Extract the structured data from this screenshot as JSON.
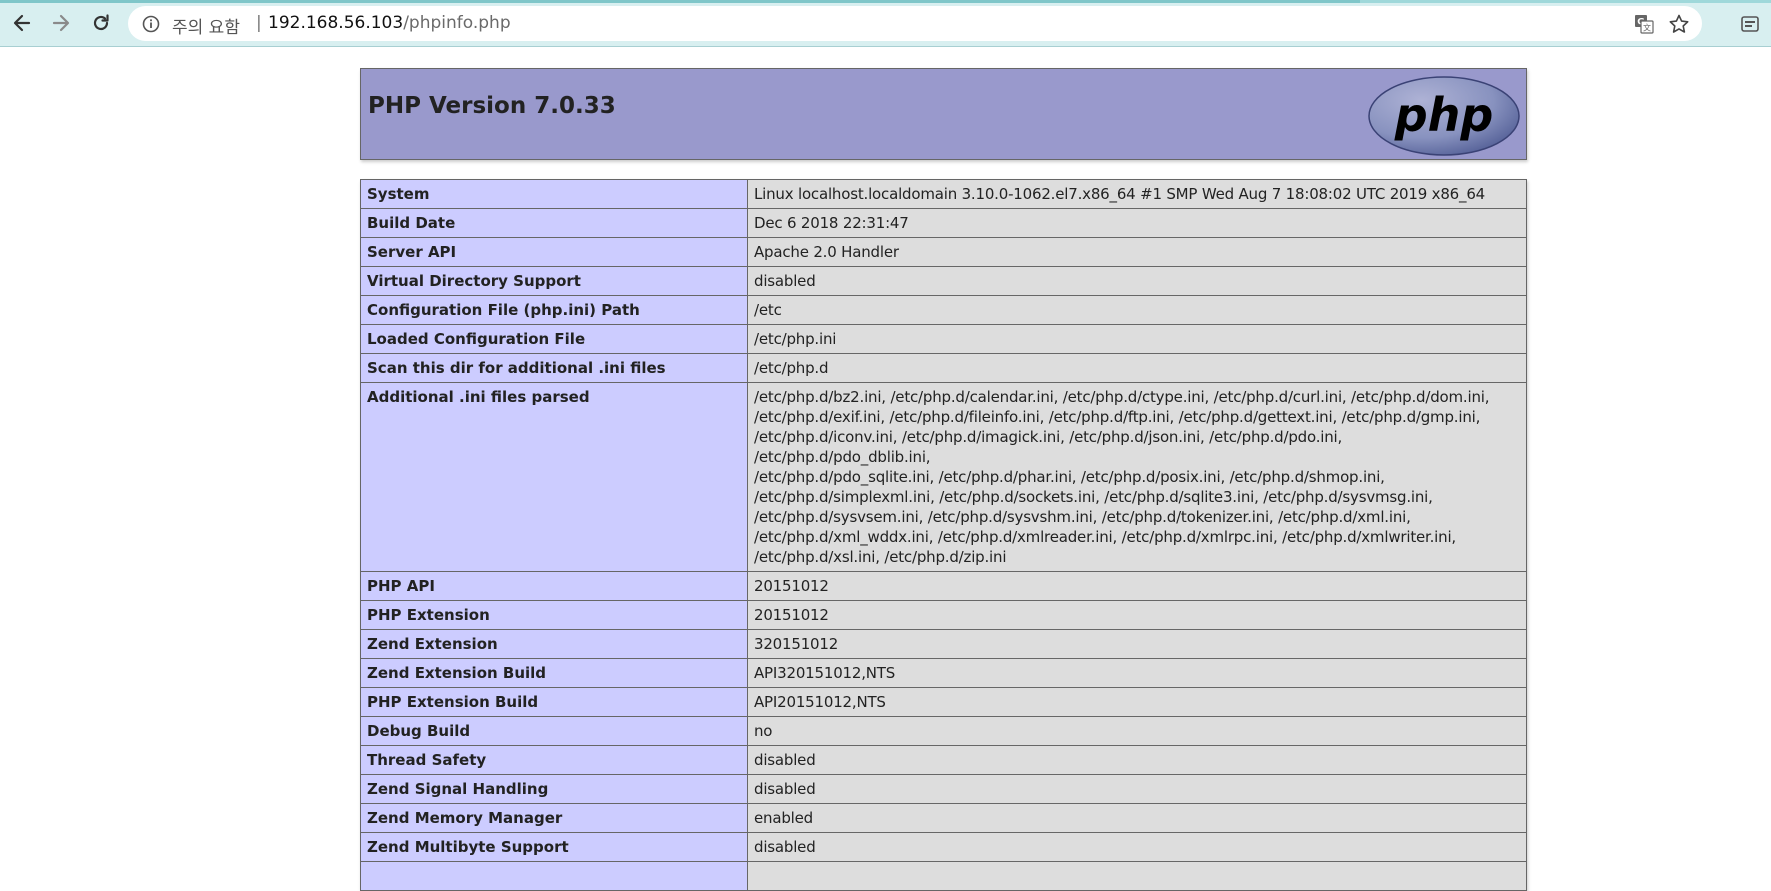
{
  "browser": {
    "security_warning": "주의 요함",
    "separator": "|",
    "url_host": "192.168.56.103",
    "url_path": "/phpinfo.php"
  },
  "page": {
    "title": "PHP Version 7.0.33",
    "logo_text": "php"
  },
  "rows": [
    {
      "key": "System",
      "value": "Linux localhost.localdomain 3.10.0-1062.el7.x86_64 #1 SMP Wed Aug 7 18:08:02 UTC 2019 x86_64"
    },
    {
      "key": "Build Date",
      "value": "Dec 6 2018 22:31:47"
    },
    {
      "key": "Server API",
      "value": "Apache 2.0 Handler"
    },
    {
      "key": "Virtual Directory Support",
      "value": "disabled"
    },
    {
      "key": "Configuration File (php.ini) Path",
      "value": "/etc"
    },
    {
      "key": "Loaded Configuration File",
      "value": "/etc/php.ini"
    },
    {
      "key": "Scan this dir for additional .ini files",
      "value": "/etc/php.d"
    },
    {
      "key": "Additional .ini files parsed",
      "value_lines": [
        "/etc/php.d/bz2.ini, /etc/php.d/calendar.ini, /etc/php.d/ctype.ini, /etc/php.d/curl.ini, /etc/php.d/dom.ini,",
        "/etc/php.d/exif.ini, /etc/php.d/fileinfo.ini, /etc/php.d/ftp.ini, /etc/php.d/gettext.ini, /etc/php.d/gmp.ini,",
        "/etc/php.d/iconv.ini, /etc/php.d/imagick.ini, /etc/php.d/json.ini, /etc/php.d/pdo.ini, /etc/php.d/pdo_dblib.ini,",
        "/etc/php.d/pdo_sqlite.ini, /etc/php.d/phar.ini, /etc/php.d/posix.ini, /etc/php.d/shmop.ini,",
        "/etc/php.d/simplexml.ini, /etc/php.d/sockets.ini, /etc/php.d/sqlite3.ini, /etc/php.d/sysvmsg.ini,",
        "/etc/php.d/sysvsem.ini, /etc/php.d/sysvshm.ini, /etc/php.d/tokenizer.ini, /etc/php.d/xml.ini,",
        "/etc/php.d/xml_wddx.ini, /etc/php.d/xmlreader.ini, /etc/php.d/xmlrpc.ini, /etc/php.d/xmlwriter.ini,",
        "/etc/php.d/xsl.ini, /etc/php.d/zip.ini"
      ]
    },
    {
      "key": "PHP API",
      "value": "20151012"
    },
    {
      "key": "PHP Extension",
      "value": "20151012"
    },
    {
      "key": "Zend Extension",
      "value": "320151012"
    },
    {
      "key": "Zend Extension Build",
      "value": "API320151012,NTS"
    },
    {
      "key": "PHP Extension Build",
      "value": "API20151012,NTS"
    },
    {
      "key": "Debug Build",
      "value": "no"
    },
    {
      "key": "Thread Safety",
      "value": "disabled"
    },
    {
      "key": "Zend Signal Handling",
      "value": "disabled"
    },
    {
      "key": "Zend Memory Manager",
      "value": "enabled"
    },
    {
      "key": "Zend Multibyte Support",
      "value": "disabled"
    },
    {
      "key": "",
      "value": ""
    }
  ],
  "colors": {
    "header_bg": "#9999cc",
    "key_bg": "#ccccff",
    "value_bg": "#dddddd",
    "chrome_bg": "#d8eff0"
  }
}
